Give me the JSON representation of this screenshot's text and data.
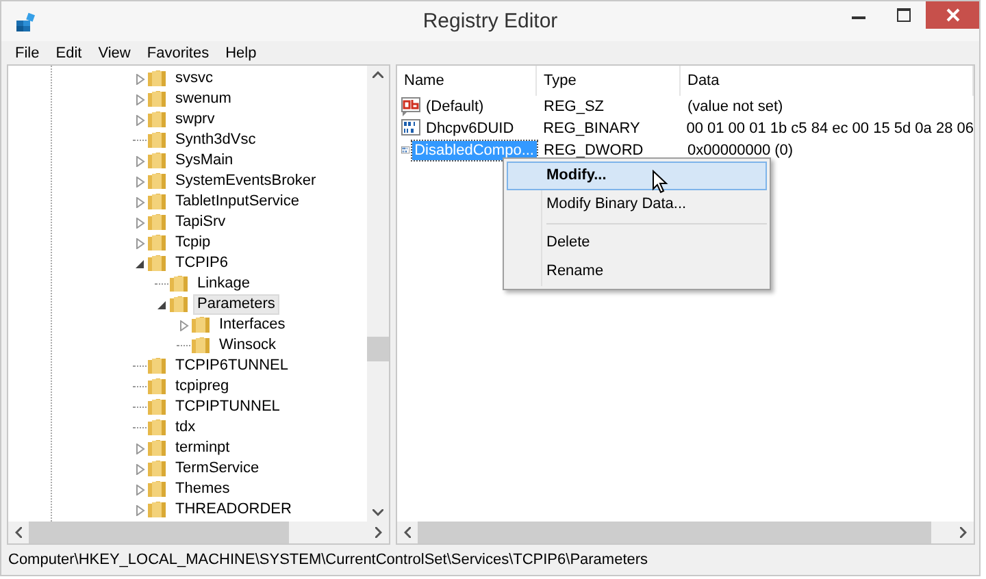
{
  "window": {
    "title": "Registry Editor"
  },
  "menu_bar": [
    "File",
    "Edit",
    "View",
    "Favorites",
    "Help"
  ],
  "tree": {
    "items": [
      {
        "label": "svsvc",
        "expandable": true,
        "expanded": false,
        "selected": false
      },
      {
        "label": "swenum",
        "expandable": true,
        "expanded": false,
        "selected": false
      },
      {
        "label": "swprv",
        "expandable": true,
        "expanded": false,
        "selected": false
      },
      {
        "label": "Synth3dVsc",
        "expandable": false,
        "expanded": false,
        "selected": false
      },
      {
        "label": "SysMain",
        "expandable": true,
        "expanded": false,
        "selected": false
      },
      {
        "label": "SystemEventsBroker",
        "expandable": true,
        "expanded": false,
        "selected": false
      },
      {
        "label": "TabletInputService",
        "expandable": true,
        "expanded": false,
        "selected": false
      },
      {
        "label": "TapiSrv",
        "expandable": true,
        "expanded": false,
        "selected": false
      },
      {
        "label": "Tcpip",
        "expandable": true,
        "expanded": false,
        "selected": false
      },
      {
        "label": "TCPIP6",
        "expandable": true,
        "expanded": true,
        "selected": false,
        "children": [
          {
            "label": "Linkage",
            "expandable": false,
            "expanded": false,
            "selected": false
          },
          {
            "label": "Parameters",
            "expandable": true,
            "expanded": true,
            "selected": true,
            "children": [
              {
                "label": "Interfaces",
                "expandable": true,
                "expanded": false,
                "selected": false
              },
              {
                "label": "Winsock",
                "expandable": false,
                "expanded": false,
                "selected": false
              }
            ]
          }
        ]
      },
      {
        "label": "TCPIP6TUNNEL",
        "expandable": false,
        "expanded": false,
        "selected": false
      },
      {
        "label": "tcpipreg",
        "expandable": false,
        "expanded": false,
        "selected": false
      },
      {
        "label": "TCPIPTUNNEL",
        "expandable": false,
        "expanded": false,
        "selected": false
      },
      {
        "label": "tdx",
        "expandable": false,
        "expanded": false,
        "selected": false
      },
      {
        "label": "terminpt",
        "expandable": true,
        "expanded": false,
        "selected": false
      },
      {
        "label": "TermService",
        "expandable": true,
        "expanded": false,
        "selected": false
      },
      {
        "label": "Themes",
        "expandable": true,
        "expanded": false,
        "selected": false
      },
      {
        "label": "THREADORDER",
        "expandable": true,
        "expanded": false,
        "selected": false
      }
    ]
  },
  "values": {
    "columns": [
      "Name",
      "Type",
      "Data"
    ],
    "rows": [
      {
        "kind": "string",
        "name": "(Default)",
        "type": "REG_SZ",
        "data": "(value not set)",
        "selected": false
      },
      {
        "kind": "binary",
        "name": "Dhcpv6DUID",
        "type": "REG_BINARY",
        "data": "00 01 00 01 1b c5 84 ec 00 15 5d 0a 28 06",
        "selected": false
      },
      {
        "kind": "binary",
        "name": "DisabledCompo...",
        "type": "REG_DWORD",
        "data": "0x00000000 (0)",
        "selected": true
      }
    ]
  },
  "context_menu": {
    "groups": [
      [
        {
          "label": "Modify...",
          "default": true,
          "selected": true
        },
        {
          "label": "Modify Binary Data...",
          "default": false,
          "selected": false
        }
      ],
      [
        {
          "label": "Delete",
          "default": false,
          "selected": false
        },
        {
          "label": "Rename",
          "default": false,
          "selected": false
        }
      ]
    ]
  },
  "status_bar": "Computer\\HKEY_LOCAL_MACHINE\\SYSTEM\\CurrentControlSet\\Services\\TCPIP6\\Parameters"
}
